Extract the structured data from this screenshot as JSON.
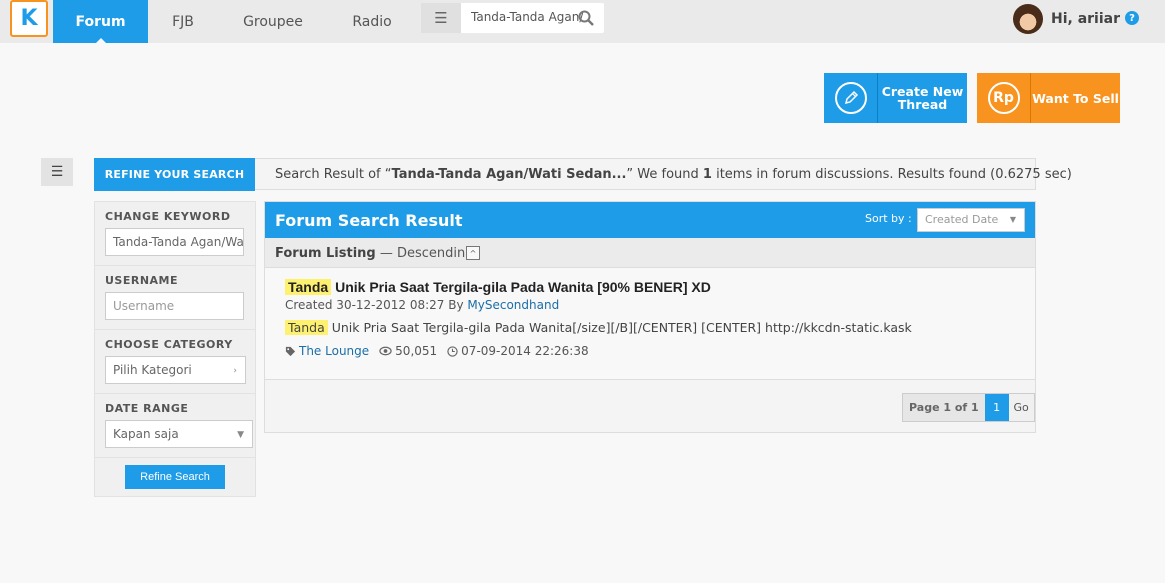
{
  "nav": {
    "logo": "K",
    "tabs": [
      {
        "label": "Forum",
        "active": true
      },
      {
        "label": "FJB"
      },
      {
        "label": "Groupee"
      },
      {
        "label": "Radio"
      }
    ],
    "search_value": "Tanda-Tanda Agan/Wati Sedang Jatuh Cinta",
    "user_greeting": "Hi, ariiar",
    "help": "?"
  },
  "actions": {
    "create_thread": "Create New Thread",
    "create_icon": "pencil-icon",
    "want_to_sell": "Want To Sell",
    "sell_icon_text": "Rp"
  },
  "result_bar": {
    "refine_tab": "REFINE YOUR SEARCH",
    "prefix": "Search Result of “",
    "keyword": "Tanda-Tanda Agan/Wati Sedan...",
    "middle": "” We found ",
    "count": "1",
    "suffix": " items in forum discussions. Results found (0.6275 sec)"
  },
  "sidebar": {
    "keyword_title": "CHANGE KEYWORD",
    "keyword_value": "Tanda-Tanda Agan/Wati Sedang",
    "username_title": "USERNAME",
    "username_placeholder": "Username",
    "category_title": "CHOOSE CATEGORY",
    "category_value": "Pilih Kategori",
    "date_title": "DATE RANGE",
    "date_value": "Kapan saja",
    "refine_button": "Refine Search"
  },
  "panel": {
    "title": "Forum Search Result",
    "sort_label": "Sort by :",
    "sort_value": "Created Date",
    "listing_label": "Forum Listing",
    "listing_order": " — Descending",
    "collapse": "^"
  },
  "results": [
    {
      "highlight": "Tanda",
      "title_rest": " Unik Pria Saat Tergila-gila Pada Wanita [90% BENER] XD",
      "created_prefix": "Created 30-12-2012 08:27 By ",
      "author": "MySecondhand",
      "snippet_highlight": "Tanda",
      "snippet_rest": " Unik Pria Saat Tergila-gila Pada Wanita[/size][/B][/CENTER] [CENTER] http://kkcdn-static.kask",
      "category": "The Lounge",
      "views": "50,051",
      "last_update": "07-09-2014 22:26:38"
    }
  ],
  "pager": {
    "label": "Page 1 of 1",
    "current": "1",
    "go": "Go"
  },
  "colors": {
    "accent": "#1e9ce8",
    "orange": "#f7931e",
    "highlight": "#fff170"
  }
}
